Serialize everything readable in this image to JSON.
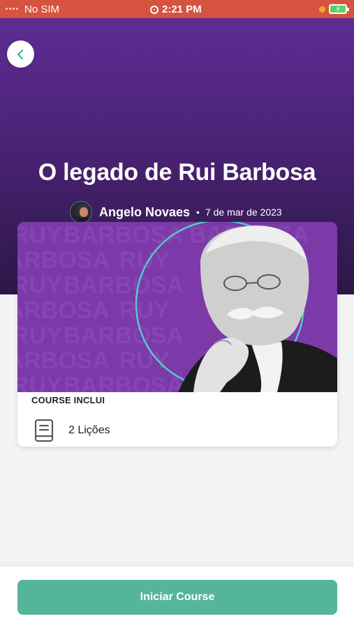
{
  "status_bar": {
    "carrier": "No SIM",
    "time": "2:21 PM",
    "icons": [
      "signal-dots-icon",
      "alarm-icon",
      "orange-dot-indicator",
      "battery-charging-icon"
    ],
    "battery_color": "#5fcf6b"
  },
  "header": {
    "back_icon": "chevron-left-icon",
    "title": "O legado de Rui Barbosa",
    "author": "Angelo Novaes",
    "separator": "•",
    "date": "7 de mar de 2023",
    "gradient_colors": [
      "#5e2c94",
      "#2c1746"
    ]
  },
  "course_card": {
    "cover_watermark_words": [
      "RUY",
      "BARBOSA"
    ],
    "cover_background": "#7b3aa8",
    "cover_ring_color": "#55c9c8",
    "section_label": "COURSE INCLUI",
    "lessons_icon": "book-icon",
    "lessons_text": "2 Lições"
  },
  "footer": {
    "start_label": "Iniciar Course",
    "accent_color": "#55b59b"
  }
}
